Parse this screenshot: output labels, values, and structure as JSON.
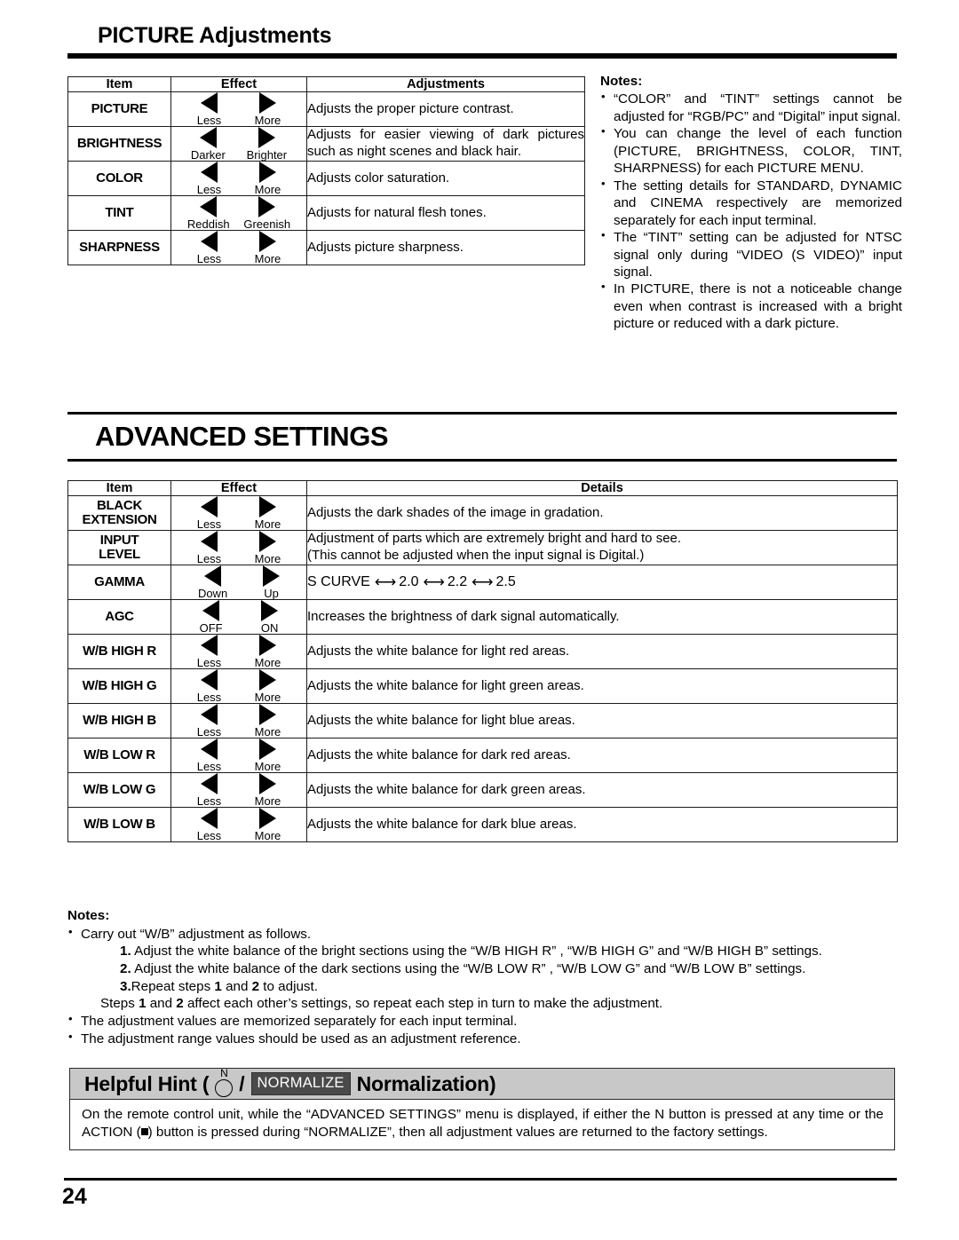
{
  "section1": {
    "title": "PICTURE Adjustments",
    "table": {
      "headers": [
        "Item",
        "Effect",
        "Adjustments"
      ],
      "rows": [
        {
          "item": "PICTURE",
          "left_label": "Less",
          "right_label": "More",
          "detail": "Adjusts the proper picture contrast."
        },
        {
          "item": "BRIGHTNESS",
          "left_label": "Darker",
          "right_label": "Brighter",
          "detail": "Adjusts for easier viewing of dark pictures such as night scenes and black hair."
        },
        {
          "item": "COLOR",
          "left_label": "Less",
          "right_label": "More",
          "detail": "Adjusts color saturation."
        },
        {
          "item": "TINT",
          "left_label": "Reddish",
          "right_label": "Greenish",
          "detail": "Adjusts for natural flesh tones."
        },
        {
          "item": "SHARPNESS",
          "left_label": "Less",
          "right_label": "More",
          "detail": "Adjusts picture sharpness."
        }
      ]
    },
    "notes": {
      "heading": "Notes:",
      "items": [
        "“COLOR” and “TINT” settings cannot be adjusted for “RGB/PC” and “Digital” input signal.",
        "You can change the level of each function (PICTURE, BRIGHTNESS, COLOR, TINT, SHARPNESS) for each PICTURE MENU.",
        "The setting details for STANDARD, DYNAMIC and CINEMA respectively are memorized separately for each input terminal.",
        "The “TINT” setting can be adjusted for NTSC signal only during “VIDEO (S VIDEO)” input signal.",
        "In PICTURE, there is not a noticeable change even when contrast is increased with a bright picture or reduced with a dark picture."
      ]
    }
  },
  "section2": {
    "title": "ADVANCED SETTINGS",
    "table": {
      "headers": [
        "Item",
        "Effect",
        "Details"
      ],
      "rows": [
        {
          "item": "BLACK\nEXTENSION",
          "left_label": "Less",
          "right_label": "More",
          "detail": "Adjusts the dark shades of the image in gradation."
        },
        {
          "item": "INPUT\nLEVEL",
          "left_label": "Less",
          "right_label": "More",
          "detail": "Adjustment of parts which are extremely bright and hard to see.\n(This cannot be adjusted when the input signal is Digital.)"
        },
        {
          "item": "GAMMA",
          "left_label": "Down",
          "right_label": "Up",
          "detail_gamma": [
            "S CURVE",
            "2.0",
            "2.2",
            "2.5"
          ]
        },
        {
          "item": "AGC",
          "left_label": "OFF",
          "right_label": "ON",
          "detail": "Increases the brightness of dark signal automatically."
        },
        {
          "item": "W/B HIGH R",
          "left_label": "Less",
          "right_label": "More",
          "detail": "Adjusts the white balance for light red areas."
        },
        {
          "item": "W/B HIGH G",
          "left_label": "Less",
          "right_label": "More",
          "detail": "Adjusts the white balance for light green areas."
        },
        {
          "item": "W/B HIGH B",
          "left_label": "Less",
          "right_label": "More",
          "detail": "Adjusts the white balance for light blue areas."
        },
        {
          "item": "W/B LOW R",
          "left_label": "Less",
          "right_label": "More",
          "detail": "Adjusts the white balance for dark red areas."
        },
        {
          "item": "W/B LOW G",
          "left_label": "Less",
          "right_label": "More",
          "detail": "Adjusts the white balance for dark green areas."
        },
        {
          "item": "W/B LOW B",
          "left_label": "Less",
          "right_label": "More",
          "detail": "Adjusts the white balance for dark blue areas."
        }
      ]
    },
    "notes": {
      "heading": "Notes:",
      "bullet1": "Carry out “W/B” adjustment as follows.",
      "step1_num": "1.",
      "step1": "Adjust the white balance of the bright sections using the “W/B HIGH R” , “W/B HIGH G” and “W/B HIGH B” settings.",
      "step2_num": "2.",
      "step2": "Adjust the white balance of the dark sections using the “W/B LOW R” , “W/B LOW G” and “W/B LOW B” settings.",
      "step3_num": "3.",
      "step3_a": "Repeat steps ",
      "step3_b": "1",
      "step3_c": " and ",
      "step3_d": "2",
      "step3_e": " to adjust.",
      "steps_note_a": "Steps ",
      "steps_note_b": "1",
      "steps_note_c": " and ",
      "steps_note_d": "2",
      "steps_note_e": " affect each other’s settings, so repeat each step in turn to make the adjustment.",
      "bullet2": "The adjustment values are memorized separately for each input terminal.",
      "bullet3": "The adjustment range values should be used as an adjustment reference."
    }
  },
  "hint": {
    "title_pre": "Helpful Hint (",
    "n_button_label": "N",
    "slash": "/",
    "normalize_badge": "NORMALIZE",
    "title_post": "Normalization)",
    "body_a": "On the remote control unit, while the “ADVANCED SETTINGS” menu is displayed, if either the N button is pressed at any time or the ACTION (",
    "body_b": ") button is pressed during “NORMALIZE”, then all adjustment values are returned to the factory settings."
  },
  "footer": {
    "page_number": "24"
  }
}
